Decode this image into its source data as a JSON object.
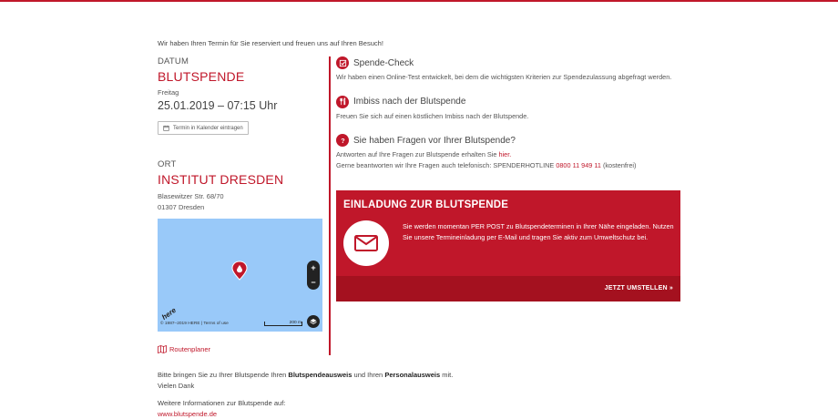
{
  "intro": "Wir haben Ihren Termin für Sie reserviert und freuen uns auf Ihren Besuch!",
  "date_section": {
    "label": "DATUM",
    "title": "BLUTSPENDE",
    "weekday": "Freitag",
    "datetime": "25.01.2019 – 07:15 Uhr",
    "calendar_button": "Termin in Kalender eintragen"
  },
  "location": {
    "label": "ORT",
    "title": "INSTITUT DRESDEN",
    "street": "Blasewitzer Str. 68/70",
    "city": "01307 Dresden"
  },
  "map": {
    "zoom_in": "+",
    "zoom_out": "−",
    "logo": "here",
    "copyright": "© 1987–2019 HERE | Terms of use",
    "scale": "200 m"
  },
  "route_link": "Routenplaner",
  "sections": [
    {
      "title": "Spende-Check",
      "body": "Wir haben einen Online-Test entwickelt, bei dem die wichtigsten Kriterien zur Spendezulassung abgefragt werden."
    },
    {
      "title": "Imbiss nach der Blutspende",
      "body": "Freuen Sie sich auf einen köstlichen Imbiss nach der Blutspende."
    },
    {
      "title": "Sie haben Fragen vor Ihrer Blutspende?",
      "body_prefix": "Antworten auf Ihre Fragen zur Blutspende erhalten Sie ",
      "body_link": "hier.",
      "body2_prefix": "Gerne beantworten wir Ihre Fragen auch telefonisch: SPENDERHOTLINE ",
      "hotline": "0800 11 949 11",
      "body2_suffix": " (kostenfrei)"
    }
  ],
  "invite": {
    "title": "EINLADUNG ZUR BLUTSPENDE",
    "text": "Sie werden momentan PER POST zu Blutspendeterminen in Ihrer Nähe eingeladen. Nutzen Sie unsere Termineinladung per E-Mail und tragen Sie aktiv zum Umweltschutz bei.",
    "button": "JETZT UMSTELLEN »"
  },
  "footer": {
    "line1_prefix": "Bitte bringen Sie zu Ihrer Blutspende Ihren ",
    "bold1": "Blutspendeausweis",
    "line1_mid": " und Ihren ",
    "bold2": "Personalausweis",
    "line1_suffix": " mit.",
    "thanks": "Vielen Dank",
    "more_info": "Weitere Informationen zur Blutspende auf:",
    "link": "www.blutspende.de"
  },
  "colors": {
    "accent": "#c0172a",
    "accent_dark": "#a4111f",
    "map_water": "#99c9f9"
  }
}
